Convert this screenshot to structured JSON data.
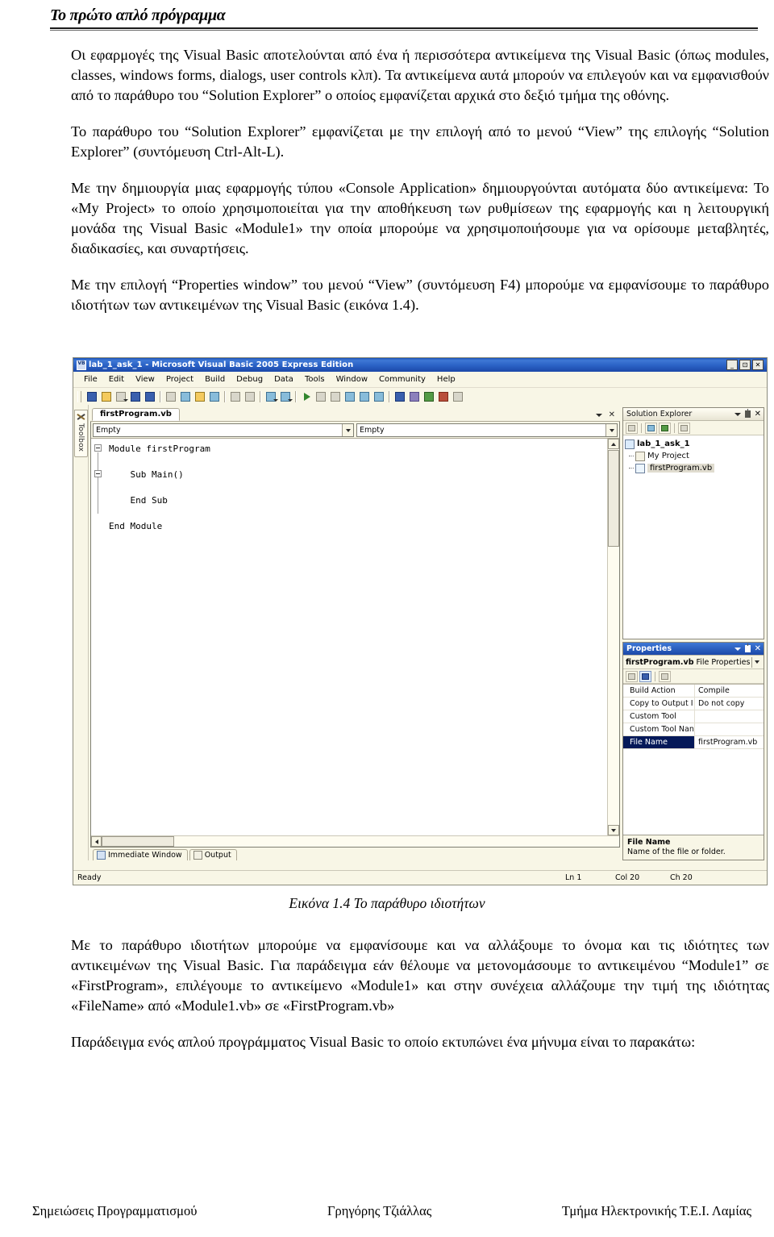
{
  "header": {
    "title": "Το πρώτο απλό πρόγραμμα"
  },
  "paragraphs_before": [
    "Οι εφαρμογές της Visual Basic αποτελούνται από ένα ή περισσότερα αντικείμενα της Visual Basic (όπως modules, classes, windows forms, dialogs, user controls κλπ). Τα αντικείμενα αυτά μπορούν να επιλεγούν και να εμφανισθούν από το παράθυρο του “Solution Explorer” ο οποίος εμφανίζεται αρχικά στο δεξιό τμήμα της οθόνης.",
    "Το παράθυρο του “Solution Explorer” εμφανίζεται με την επιλογή από το μενού “View” της επιλογής “Solution Explorer” (συντόμευση Ctrl-Alt-L).",
    "Με  την δημιουργία μιας εφαρμογής τύπου «Console Application» δημιουργούνται αυτόματα δύο αντικείμενα: Το «My Project» το οποίο χρησιμοποιείται για την αποθήκευση των ρυθμίσεων της εφαρμογής και η λειτουργική μονάδα της Visual Basic «Module1» την οποία μπορούμε να χρησιμοποιήσουμε για να ορίσουμε μεταβλητές, διαδικασίες, και συναρτήσεις.",
    "Με την επιλογή “Properties window” του μενού “View” (συντόμευση F4) μπορούμε να εμφανίσουμε το παράθυρο ιδιοτήτων των αντικειμένων της Visual Basic (εικόνα 1.4)."
  ],
  "figure": {
    "caption": "Εικόνα 1.4  Το παράθυρο ιδιοτήτων",
    "window": {
      "title": "lab_1_ask_1 - Microsoft Visual Basic 2005 Express Edition",
      "app_icon": "visual-basic-icon",
      "caption_buttons": [
        "_",
        "⊡",
        "✕"
      ],
      "menu": [
        "File",
        "Edit",
        "View",
        "Project",
        "Build",
        "Debug",
        "Data",
        "Tools",
        "Window",
        "Community",
        "Help"
      ],
      "toolbox_tab": "Toolbox",
      "editor": {
        "tab": "firstProgram.vb",
        "class_combo": "Empty",
        "member_combo": "Empty",
        "code": "Module firstProgram\n\n    Sub Main()\n\n    End Sub\n\nEnd Module"
      },
      "bottom_tabs": [
        "Immediate Window",
        "Output"
      ],
      "solution_explorer": {
        "title": "Solution Explorer",
        "tree": [
          {
            "label": "lab_1_ask_1",
            "level": 1,
            "icon": "solution-icon",
            "selected": false
          },
          {
            "label": "My Project",
            "level": 2,
            "icon": "my-project-icon",
            "selected": false
          },
          {
            "label": "firstProgram.vb",
            "level": 2,
            "icon": "vb-file-icon",
            "selected": true
          }
        ]
      },
      "properties": {
        "title": "Properties",
        "object_name": "firstProgram.vb",
        "object_type": "File Properties",
        "rows": [
          {
            "name": "Build Action",
            "value": "Compile",
            "selected": false
          },
          {
            "name": "Copy to Output I",
            "value": "Do not copy",
            "selected": false
          },
          {
            "name": "Custom Tool",
            "value": "",
            "selected": false
          },
          {
            "name": "Custom Tool Nan",
            "value": "",
            "selected": false
          },
          {
            "name": "File Name",
            "value": "firstProgram.vb",
            "selected": true
          }
        ],
        "description_title": "File Name",
        "description_text": "Name of the file or folder."
      },
      "statusbar": {
        "state": "Ready",
        "ln": "Ln 1",
        "col": "Col 20",
        "ch": "Ch 20"
      }
    }
  },
  "paragraphs_after": [
    "Με το παράθυρο ιδιοτήτων μπορούμε να εμφανίσουμε και να αλλάξουμε το όνομα και τις ιδιότητες των αντικειμένων της Visual Basic. Για παράδειγμα εάν θέλουμε να μετονομάσουμε το αντικειμένου “Module1” σε «FirstProgram», επιλέγουμε το αντικείμενο «Module1» και στην συνέχεια αλλάζουμε την τιμή της ιδιότητας «FileName» από «Module1.vb» σε «FirstProgram.vb»",
    "Παράδειγμα ενός απλού προγράμματος Visual Basic το οποίο εκτυπώνει ένα μήνυμα είναι το παρακάτω:"
  ],
  "footer": {
    "left": "Σημειώσεις Προγραμματισμού",
    "center": "Γρηγόρης Τζιάλλας",
    "right": "Τμήμα Ηλεκτρονικής Τ.Ε.Ι. Λαμίας"
  }
}
